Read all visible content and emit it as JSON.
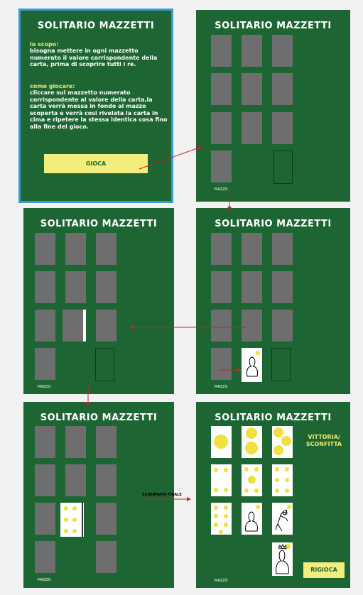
{
  "title": "SOLITARIO MAZZETTI",
  "intro": {
    "scopo_heading": "lo scopo:",
    "scopo_text": " bisogna mettere in ogni mazzetto numerato il valore corrispondente della carta, prima di scoprire tutti i re.",
    "gioca_heading": "come giocare:",
    "gioca_text": "cliccare sul mazzetto numerato corrispondente al valore della carta,la carta verrà messa in fondo al mazzo scoperta e verrà cosi rivelata la carta in cima  e ripetere la stessa identica cosa fino alla fine del gioco.",
    "button": "GIOCA"
  },
  "mazzo_label": "MAZZO",
  "final": {
    "result_line1": "VITTORIA/",
    "result_line2": "SCONFITTA",
    "button": "RIGIOCA"
  },
  "flow_label": "SCHERMATA FINALE",
  "colors": {
    "screen_bg": "#1d6633",
    "card_back": "#6e6e6e",
    "pip": "#f0e040",
    "button_bg": "#f3ee7c",
    "arrow": "#cc2222",
    "selection": "#3a9ad9"
  }
}
